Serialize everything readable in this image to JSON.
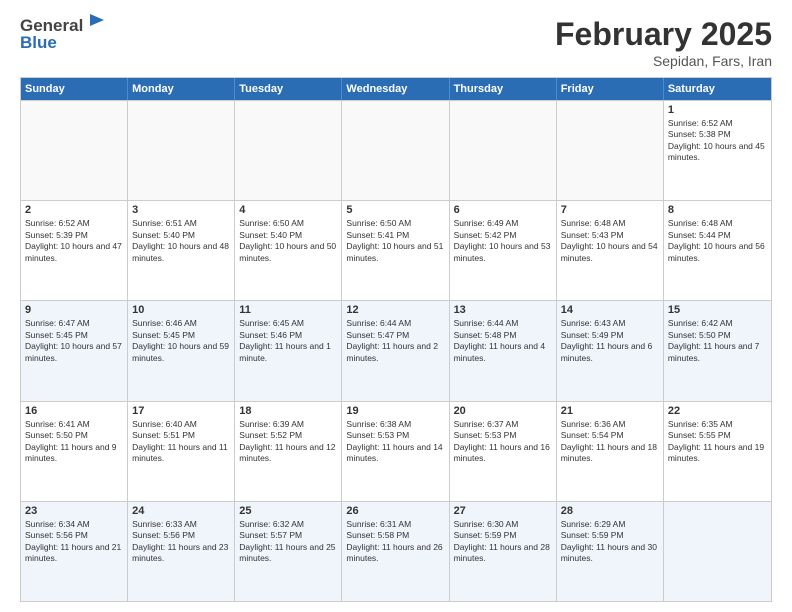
{
  "logo": {
    "general": "General",
    "blue": "Blue"
  },
  "title": "February 2025",
  "subtitle": "Sepidan, Fars, Iran",
  "header_days": [
    "Sunday",
    "Monday",
    "Tuesday",
    "Wednesday",
    "Thursday",
    "Friday",
    "Saturday"
  ],
  "rows": [
    [
      {
        "day": "",
        "text": ""
      },
      {
        "day": "",
        "text": ""
      },
      {
        "day": "",
        "text": ""
      },
      {
        "day": "",
        "text": ""
      },
      {
        "day": "",
        "text": ""
      },
      {
        "day": "",
        "text": ""
      },
      {
        "day": "1",
        "text": "Sunrise: 6:52 AM\nSunset: 5:38 PM\nDaylight: 10 hours and 45 minutes."
      }
    ],
    [
      {
        "day": "2",
        "text": "Sunrise: 6:52 AM\nSunset: 5:39 PM\nDaylight: 10 hours and 47 minutes."
      },
      {
        "day": "3",
        "text": "Sunrise: 6:51 AM\nSunset: 5:40 PM\nDaylight: 10 hours and 48 minutes."
      },
      {
        "day": "4",
        "text": "Sunrise: 6:50 AM\nSunset: 5:40 PM\nDaylight: 10 hours and 50 minutes."
      },
      {
        "day": "5",
        "text": "Sunrise: 6:50 AM\nSunset: 5:41 PM\nDaylight: 10 hours and 51 minutes."
      },
      {
        "day": "6",
        "text": "Sunrise: 6:49 AM\nSunset: 5:42 PM\nDaylight: 10 hours and 53 minutes."
      },
      {
        "day": "7",
        "text": "Sunrise: 6:48 AM\nSunset: 5:43 PM\nDaylight: 10 hours and 54 minutes."
      },
      {
        "day": "8",
        "text": "Sunrise: 6:48 AM\nSunset: 5:44 PM\nDaylight: 10 hours and 56 minutes."
      }
    ],
    [
      {
        "day": "9",
        "text": "Sunrise: 6:47 AM\nSunset: 5:45 PM\nDaylight: 10 hours and 57 minutes."
      },
      {
        "day": "10",
        "text": "Sunrise: 6:46 AM\nSunset: 5:45 PM\nDaylight: 10 hours and 59 minutes."
      },
      {
        "day": "11",
        "text": "Sunrise: 6:45 AM\nSunset: 5:46 PM\nDaylight: 11 hours and 1 minute."
      },
      {
        "day": "12",
        "text": "Sunrise: 6:44 AM\nSunset: 5:47 PM\nDaylight: 11 hours and 2 minutes."
      },
      {
        "day": "13",
        "text": "Sunrise: 6:44 AM\nSunset: 5:48 PM\nDaylight: 11 hours and 4 minutes."
      },
      {
        "day": "14",
        "text": "Sunrise: 6:43 AM\nSunset: 5:49 PM\nDaylight: 11 hours and 6 minutes."
      },
      {
        "day": "15",
        "text": "Sunrise: 6:42 AM\nSunset: 5:50 PM\nDaylight: 11 hours and 7 minutes."
      }
    ],
    [
      {
        "day": "16",
        "text": "Sunrise: 6:41 AM\nSunset: 5:50 PM\nDaylight: 11 hours and 9 minutes."
      },
      {
        "day": "17",
        "text": "Sunrise: 6:40 AM\nSunset: 5:51 PM\nDaylight: 11 hours and 11 minutes."
      },
      {
        "day": "18",
        "text": "Sunrise: 6:39 AM\nSunset: 5:52 PM\nDaylight: 11 hours and 12 minutes."
      },
      {
        "day": "19",
        "text": "Sunrise: 6:38 AM\nSunset: 5:53 PM\nDaylight: 11 hours and 14 minutes."
      },
      {
        "day": "20",
        "text": "Sunrise: 6:37 AM\nSunset: 5:53 PM\nDaylight: 11 hours and 16 minutes."
      },
      {
        "day": "21",
        "text": "Sunrise: 6:36 AM\nSunset: 5:54 PM\nDaylight: 11 hours and 18 minutes."
      },
      {
        "day": "22",
        "text": "Sunrise: 6:35 AM\nSunset: 5:55 PM\nDaylight: 11 hours and 19 minutes."
      }
    ],
    [
      {
        "day": "23",
        "text": "Sunrise: 6:34 AM\nSunset: 5:56 PM\nDaylight: 11 hours and 21 minutes."
      },
      {
        "day": "24",
        "text": "Sunrise: 6:33 AM\nSunset: 5:56 PM\nDaylight: 11 hours and 23 minutes."
      },
      {
        "day": "25",
        "text": "Sunrise: 6:32 AM\nSunset: 5:57 PM\nDaylight: 11 hours and 25 minutes."
      },
      {
        "day": "26",
        "text": "Sunrise: 6:31 AM\nSunset: 5:58 PM\nDaylight: 11 hours and 26 minutes."
      },
      {
        "day": "27",
        "text": "Sunrise: 6:30 AM\nSunset: 5:59 PM\nDaylight: 11 hours and 28 minutes."
      },
      {
        "day": "28",
        "text": "Sunrise: 6:29 AM\nSunset: 5:59 PM\nDaylight: 11 hours and 30 minutes."
      },
      {
        "day": "",
        "text": ""
      }
    ]
  ]
}
